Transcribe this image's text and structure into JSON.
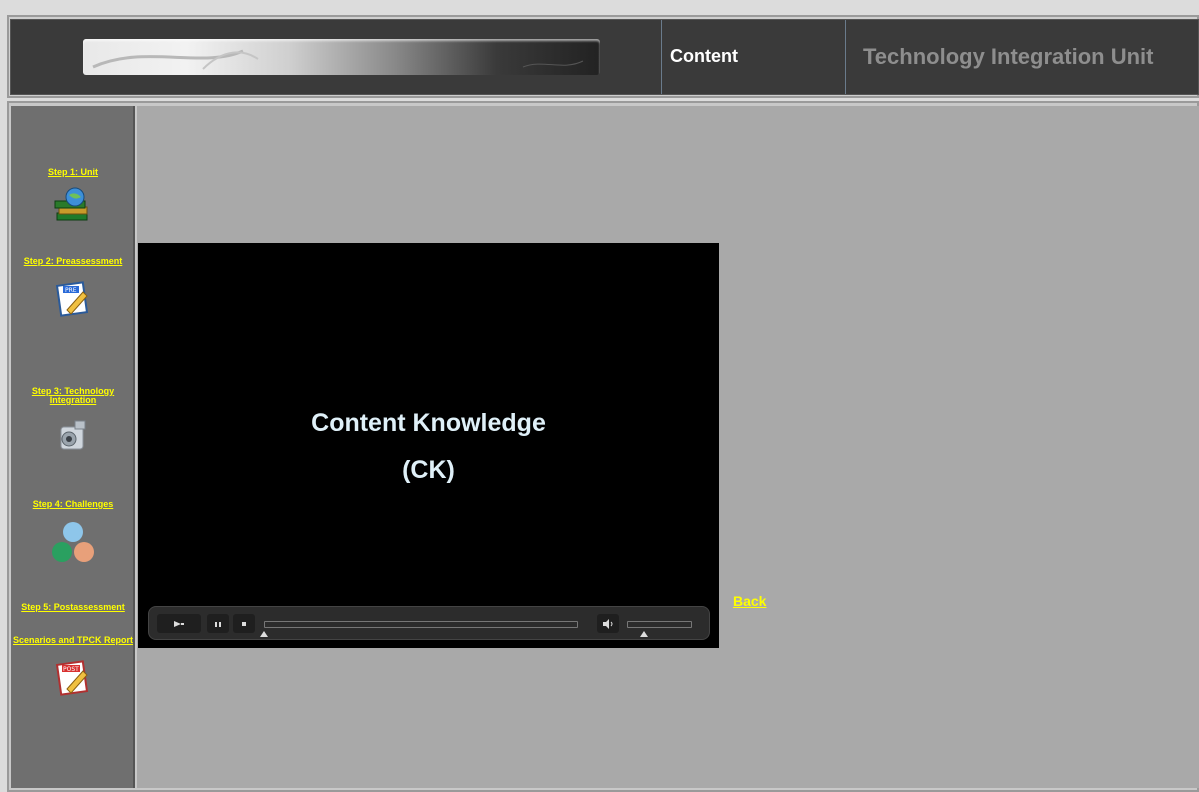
{
  "header": {
    "section_label": "Content",
    "app_title": "Technology Integration Unit"
  },
  "sidebar": {
    "steps": [
      {
        "label": "Step 1: Unit",
        "icon": "books-globe-icon"
      },
      {
        "label": "Step 2: Preassessment",
        "icon": "pre-test-pencil-icon"
      },
      {
        "label": "Step 3: Technology Integration",
        "icon": "video-camera-icon"
      },
      {
        "label": "Step 4: Challenges",
        "icon": "venn-circles-icon"
      },
      {
        "label": "Step 5: Postassessment",
        "icon": ""
      },
      {
        "label": "Scenarios and TPCK Report",
        "icon": "post-test-pencil-icon"
      }
    ]
  },
  "video": {
    "title_line1": "Content Knowledge",
    "title_line2": "(CK)",
    "controls": {
      "play_icon": "play-icon",
      "pause_icon": "pause-icon",
      "stop_icon": "stop-icon",
      "volume_icon": "speaker-icon"
    }
  },
  "back_link": "Back",
  "colors": {
    "link": "#ffff00",
    "sidebar_bg": "#6f6f6f",
    "main_bg": "#a9a9a9",
    "header_bg": "#3a3a3a"
  }
}
